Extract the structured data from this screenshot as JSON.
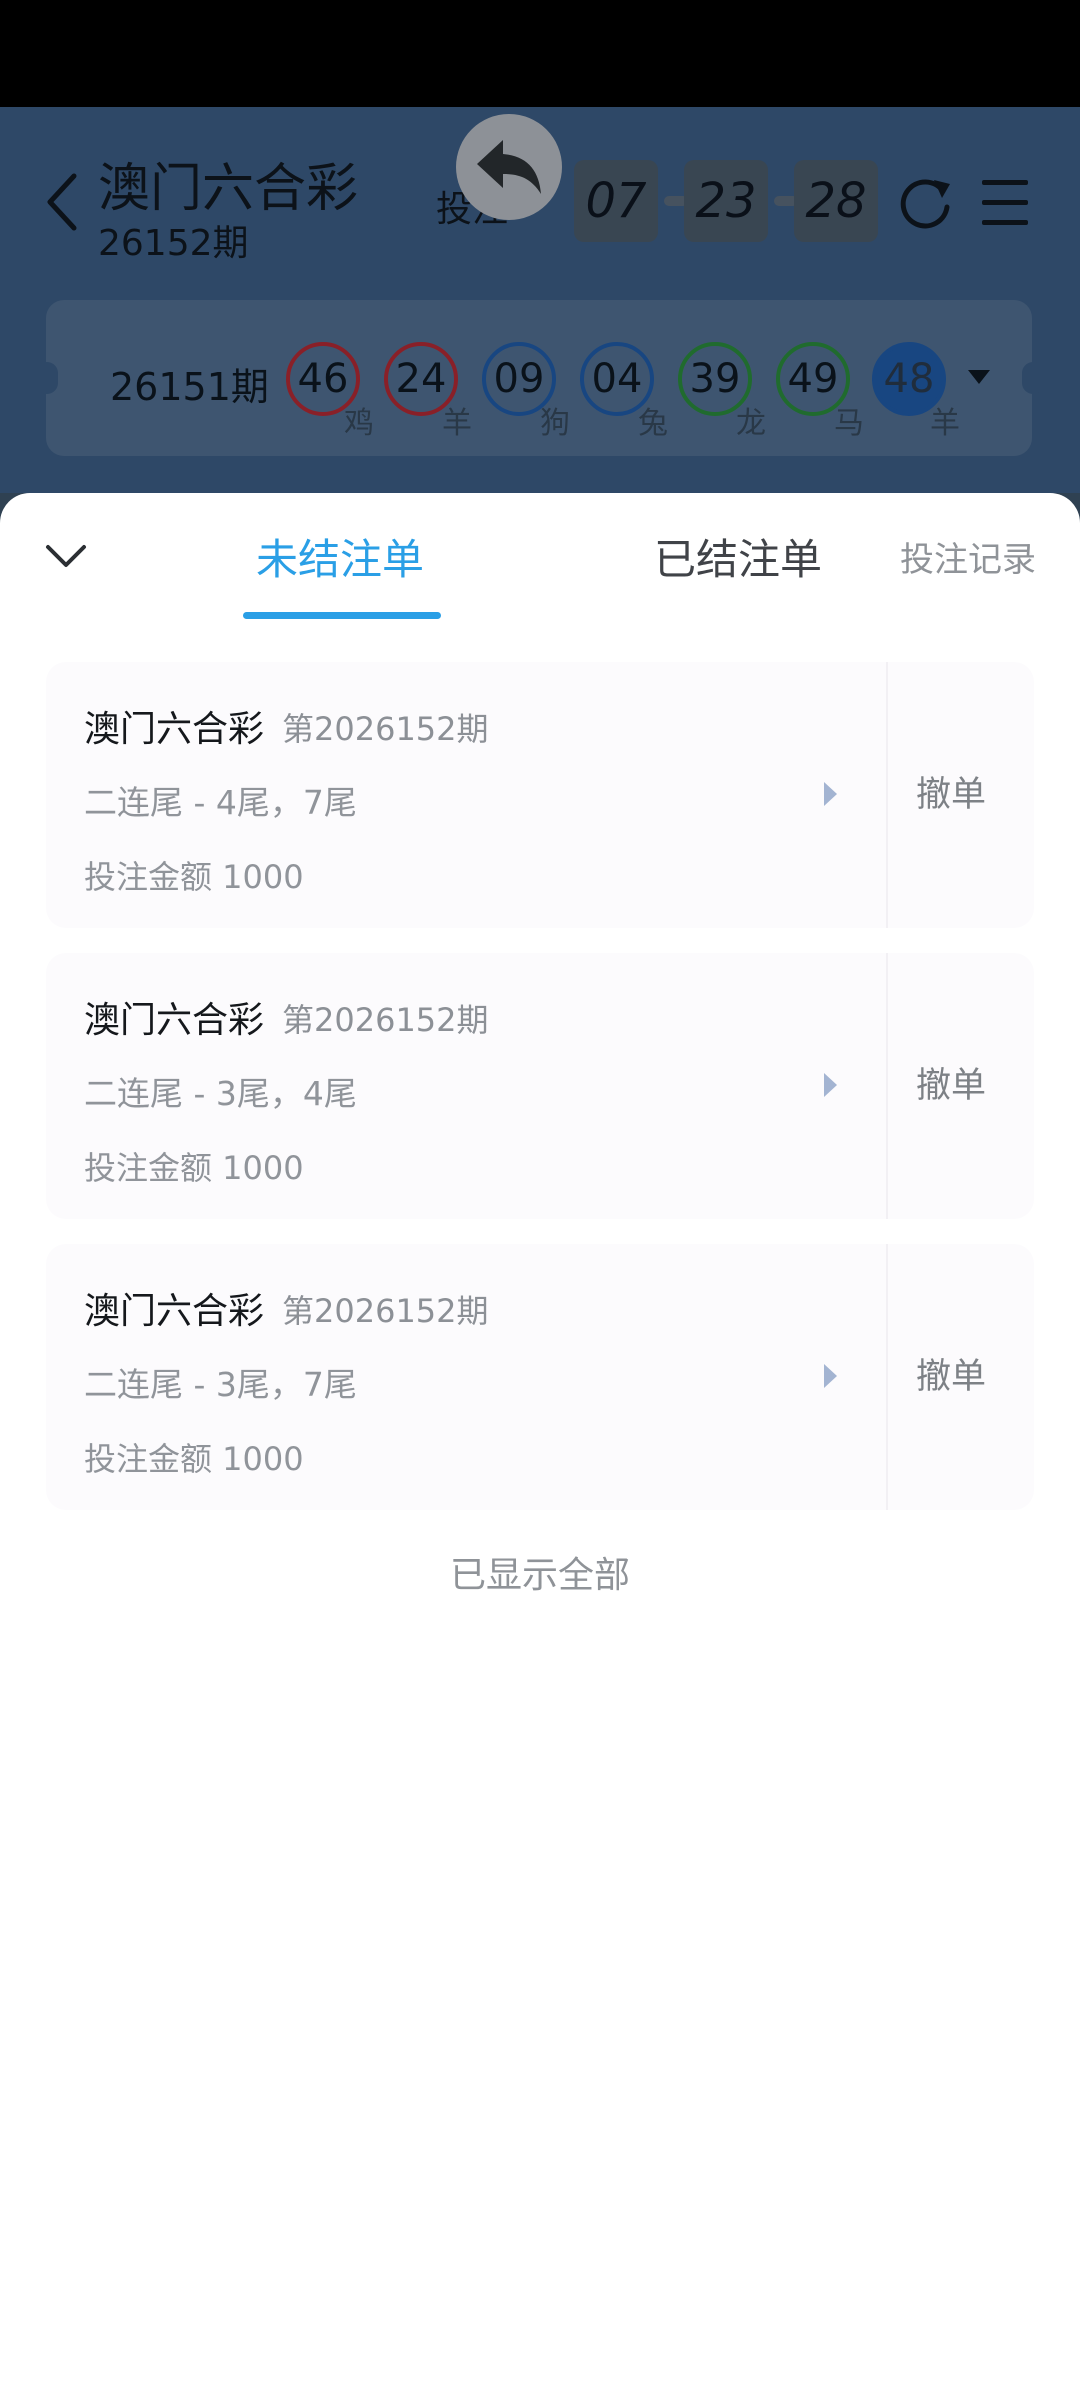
{
  "header": {
    "title": "澳门六合彩",
    "period": "26152期",
    "bet_label": "投注",
    "countdown": [
      "07",
      "23",
      "28"
    ]
  },
  "last_result": {
    "period": "26151期",
    "balls": [
      {
        "number": "46",
        "zodiac": "鸡",
        "color": "#b02a34"
      },
      {
        "number": "24",
        "zodiac": "羊",
        "color": "#b02a34"
      },
      {
        "number": "09",
        "zodiac": "狗",
        "color": "#1f5aa6"
      },
      {
        "number": "04",
        "zodiac": "兔",
        "color": "#1f5aa6"
      },
      {
        "number": "39",
        "zodiac": "龙",
        "color": "#2a8a3c"
      },
      {
        "number": "49",
        "zodiac": "马",
        "color": "#2a8a3c"
      },
      {
        "number": "48",
        "zodiac": "羊",
        "color": "#1f5aa6"
      }
    ]
  },
  "tabs": {
    "open": "未结注单",
    "settled": "已结注单",
    "history": "投注记录"
  },
  "orders": [
    {
      "title": "澳门六合彩",
      "period": "第2026152期",
      "play": "二连尾 - 4尾，7尾",
      "amount": "投注金额 1000",
      "cancel": "撤单"
    },
    {
      "title": "澳门六合彩",
      "period": "第2026152期",
      "play": "二连尾 - 3尾，4尾",
      "amount": "投注金额 1000",
      "cancel": "撤单"
    },
    {
      "title": "澳门六合彩",
      "period": "第2026152期",
      "play": "二连尾 - 3尾，7尾",
      "amount": "投注金额 1000",
      "cancel": "撤单"
    }
  ],
  "footer": {
    "all_shown": "已显示全部"
  },
  "colors": {
    "accent": "#2a9fe6",
    "header_bg": "#3c5d84",
    "card_bg": "#fcfbfd"
  },
  "icons": {
    "back": "chevron-left-icon",
    "float_back": "reply-arrow-icon",
    "refresh": "refresh-icon",
    "menu": "menu-icon",
    "collapse": "chevron-down-icon",
    "expand": "caret-down-icon",
    "order_arrow": "caret-right-icon"
  }
}
